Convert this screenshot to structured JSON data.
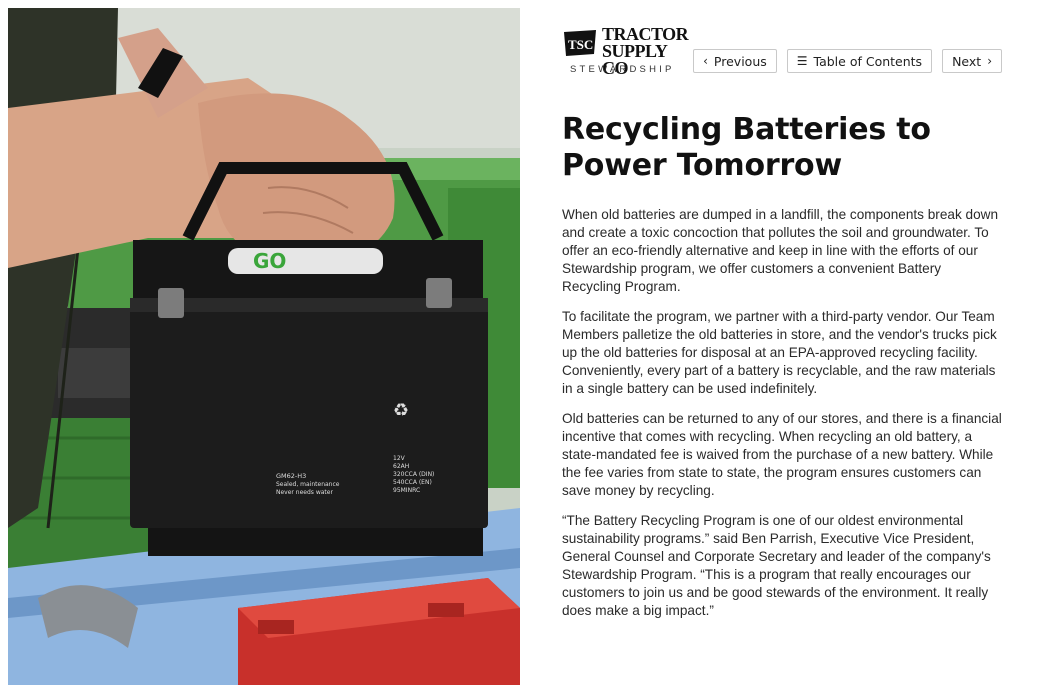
{
  "brand": {
    "mark": "TSC",
    "name_line1": "TRACTOR",
    "name_line2": "SUPPLY CO",
    "subtitle": "STEWARDSHIP"
  },
  "nav": {
    "previous_label": "Previous",
    "toc_label": "Table of Contents",
    "next_label": "Next",
    "previous_icon": "chevron-left-icon",
    "toc_icon": "list-icon",
    "next_icon": "chevron-right-icon"
  },
  "article": {
    "title": "Recycling Batteries to Power Tomorrow",
    "paragraphs": [
      "When old batteries are dumped in a landfill, the components break down and create a toxic concoction that pollutes the soil and groundwater. To offer an eco-friendly alternative and keep in line with the efforts of our Stewardship program, we offer customers a convenient Battery Recycling Program.",
      "To facilitate the program, we partner with a third-party vendor. Our Team Members palletize the old batteries in store, and the vendor's trucks pick up the old batteries for disposal at an EPA-approved recycling facility. Conveniently, every part of a battery is recyclable, and the raw materials in a single battery can be used indefinitely.",
      "Old batteries can be returned to any of our stores, and there is a financial incentive that comes with recycling. When recycling an old battery, a state-mandated fee is waived from the purchase of a new battery. While the fee varies from state to state, the program ensures customers can save money by recycling.",
      "“The Battery Recycling Program is one of our oldest environmental sustainability programs.” said Ben Parrish, Executive Vice President, General Counsel and Corporate Secretary and leader of the company's Stewardship Program. “This is a program that really encourages our customers to join us and be good stewards of the environment. It really does make a big impact.”"
    ]
  },
  "photo": {
    "battery_label_model": "GM62-H3",
    "battery_label_text1": "Sealed, maintenance",
    "battery_label_text2": "Never needs water",
    "battery_spec1": "12V",
    "battery_spec2": "62AH",
    "battery_spec3": "320CCA (DIN)",
    "battery_spec4": "540CCA (EN)",
    "battery_spec5": "95MINRC",
    "battery_brand": "GO",
    "colors": {
      "battery": "#1c1c1c",
      "crate": "#3f8f3a",
      "bin": "#7fa8d8",
      "red_battery": "#c8302b"
    }
  }
}
